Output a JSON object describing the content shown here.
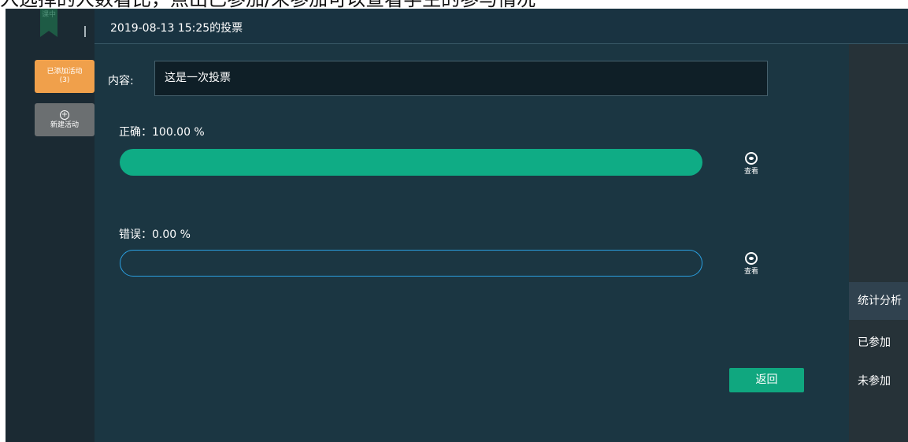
{
  "caption": "入选择的人数看比，点出已参加/未参加可以查看学生的参与情况",
  "logo_text": "课中",
  "sidebar": {
    "added_label": "已添加活动",
    "added_count": "(3)",
    "new_label": "新建活动"
  },
  "header": {
    "title": "2019-08-13 15:25的投票"
  },
  "content": {
    "label": "内容:",
    "value": "这是一次投票"
  },
  "options": [
    {
      "label": "正确：100.00 %",
      "percent": 100,
      "view_label": "查看"
    },
    {
      "label": "错误：0.00 %",
      "percent": 0,
      "view_label": "查看"
    }
  ],
  "back_label": "返回",
  "right_panel": {
    "items": [
      "统计分析",
      "已参加",
      "未参加"
    ],
    "active": "统计分析"
  },
  "colors": {
    "accent_green": "#0fac85",
    "accent_orange": "#f0a04b",
    "outline_blue": "#2a9fe0",
    "background": "#1b3642"
  }
}
